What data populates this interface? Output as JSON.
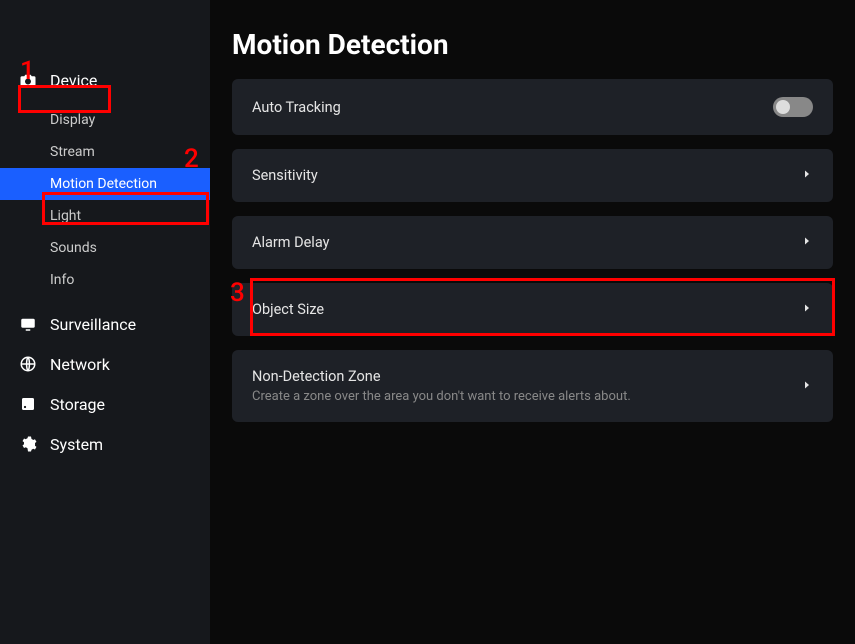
{
  "page_title": "Motion Detection",
  "sidebar": {
    "sections": [
      {
        "id": "device",
        "label": "Device",
        "icon": "camera-icon",
        "expanded": true,
        "subitems": [
          {
            "id": "display",
            "label": "Display",
            "active": false
          },
          {
            "id": "stream",
            "label": "Stream",
            "active": false
          },
          {
            "id": "motion-detection",
            "label": "Motion Detection",
            "active": true
          },
          {
            "id": "light",
            "label": "Light",
            "active": false
          },
          {
            "id": "sounds",
            "label": "Sounds",
            "active": false
          },
          {
            "id": "info",
            "label": "Info",
            "active": false
          }
        ]
      },
      {
        "id": "surveillance",
        "label": "Surveillance",
        "icon": "monitor-icon",
        "expanded": false
      },
      {
        "id": "network",
        "label": "Network",
        "icon": "globe-icon",
        "expanded": false
      },
      {
        "id": "storage",
        "label": "Storage",
        "icon": "disk-icon",
        "expanded": false
      },
      {
        "id": "system",
        "label": "System",
        "icon": "gear-icon",
        "expanded": false
      }
    ]
  },
  "cards": [
    {
      "id": "auto-tracking",
      "title": "Auto Tracking",
      "type": "toggle",
      "value": false
    },
    {
      "id": "sensitivity",
      "title": "Sensitivity",
      "type": "nav"
    },
    {
      "id": "alarm-delay",
      "title": "Alarm Delay",
      "type": "nav"
    },
    {
      "id": "object-size",
      "title": "Object Size",
      "type": "nav"
    },
    {
      "id": "non-detection-zone",
      "title": "Non-Detection Zone",
      "subtitle": "Create a zone over the area you don't want to receive alerts about.",
      "type": "nav"
    }
  ],
  "annotations": {
    "1": "1",
    "2": "2",
    "3": "3"
  }
}
